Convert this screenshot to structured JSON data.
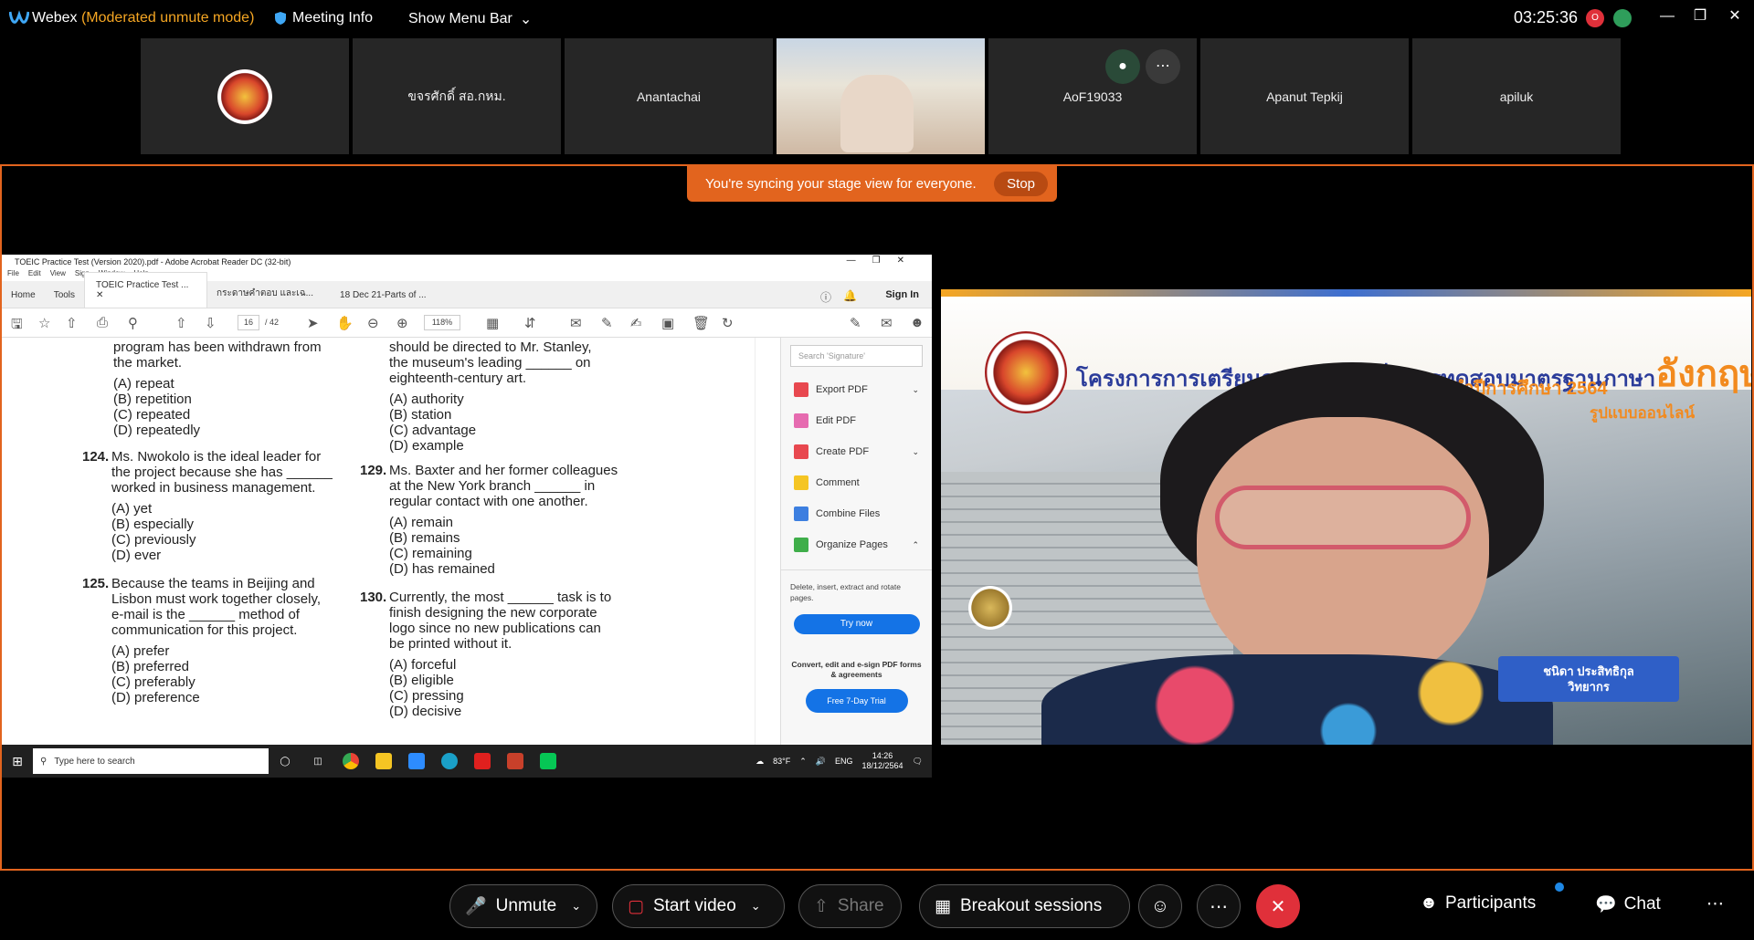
{
  "topbar": {
    "app_name": "Webex",
    "mode": "(Moderated unmute mode)",
    "meeting_info": "Meeting Info",
    "show_menu": "Show Menu Bar",
    "clock": "03:25:36",
    "rec_letter": "O"
  },
  "tiles": [
    {
      "name": ""
    },
    {
      "name": "ขจรศักดิ์ สอ.กหม."
    },
    {
      "name": "Anantachai"
    },
    {
      "name": ""
    },
    {
      "name": "AoF19033"
    },
    {
      "name": "Apanut Tepkij"
    },
    {
      "name": "apiluk"
    }
  ],
  "stage": {
    "sync_text": "You're syncing your stage view for everyone.",
    "stop_label": "Stop"
  },
  "acrobat": {
    "title": "TOEIC Practice Test (Version 2020).pdf - Adobe Acrobat Reader DC (32-bit)",
    "menu": [
      "File",
      "Edit",
      "View",
      "Sign",
      "Window",
      "Help"
    ],
    "tabs": {
      "home": "Home",
      "tools": "Tools",
      "doc1": "TOEIC Practice Test ...",
      "doc2": "กระดาษคำตอบ และเฉ...",
      "doc3": "18 Dec 21-Parts of ..."
    },
    "sign_in": "Sign In",
    "page_current": "16",
    "page_total": "/ 42",
    "zoom": "118%",
    "search_placeholder": "Search 'Signature'",
    "panel_items": [
      "Export PDF",
      "Edit PDF",
      "Create PDF",
      "Comment",
      "Combine Files",
      "Organize Pages"
    ],
    "panel_desc": "Delete, insert, extract and rotate pages.",
    "try_now": "Try now",
    "promo": "Convert, edit and e-sign PDF forms & agreements",
    "free_trial": "Free 7-Day Trial"
  },
  "doc": {
    "left": {
      "top_lines": [
        "program has been withdrawn from",
        "the market."
      ],
      "top_opts": [
        "(A) repeat",
        "(B) repetition",
        "(C) repeated",
        "(D) repeatedly"
      ],
      "q124_num": "124.",
      "q124": [
        "Ms. Nwokolo is the ideal leader for",
        "the project because she has ______",
        "worked in business management."
      ],
      "q124_opts": [
        "(A) yet",
        "(B) especially",
        "(C) previously",
        "(D) ever"
      ],
      "q125_num": "125.",
      "q125": [
        "Because the teams in Beijing and",
        "Lisbon must work together closely,",
        "e-mail is the ______ method of",
        "communication for this project."
      ],
      "q125_opts": [
        "(A) prefer",
        "(B) preferred",
        "(C) preferably",
        "(D) preference"
      ]
    },
    "right": {
      "top_lines": [
        "should be directed to Mr. Stanley,",
        "the museum's leading ______ on",
        "eighteenth-century art."
      ],
      "top_opts": [
        "(A) authority",
        "(B) station",
        "(C) advantage",
        "(D) example"
      ],
      "q129_num": "129.",
      "q129": [
        "Ms. Baxter and her former colleagues",
        "at the New York branch ______ in",
        "regular contact with one another."
      ],
      "q129_opts": [
        "(A) remain",
        "(B) remains",
        "(C) remaining",
        "(D) has remained"
      ],
      "q130_num": "130.",
      "q130": [
        "Currently, the most ______ task is to",
        "finish designing the new corporate",
        "logo since no new publications can",
        "be printed without it."
      ],
      "q130_opts": [
        "(A) forceful",
        "(B) eligible",
        "(C) pressing",
        "(D) decisive"
      ]
    }
  },
  "taskbar": {
    "search_placeholder": "Type here to search",
    "weather": "83°F",
    "lang": "ENG",
    "time": "14:26",
    "date": "18/12/2564"
  },
  "speaker": {
    "banner_title": "โครงการการเตรียมความพร้อมเพื่อการทดสอบมาตรฐานภาษา",
    "banner_big": "อังกฤษ",
    "banner_sub": "TOEIC ประจำปีการศึกษา 2564",
    "banner_sub2": "รูปแบบออนไลน์",
    "name": "ชนิดา ประสิทธิกุล",
    "role": "วิทยากร"
  },
  "controls": {
    "unmute": "Unmute",
    "start_video": "Start video",
    "share": "Share",
    "breakout": "Breakout sessions",
    "participants": "Participants",
    "chat": "Chat"
  },
  "colors": {
    "accent": "#e2641e",
    "leave": "#e0303a",
    "mode": "#f5a623"
  }
}
